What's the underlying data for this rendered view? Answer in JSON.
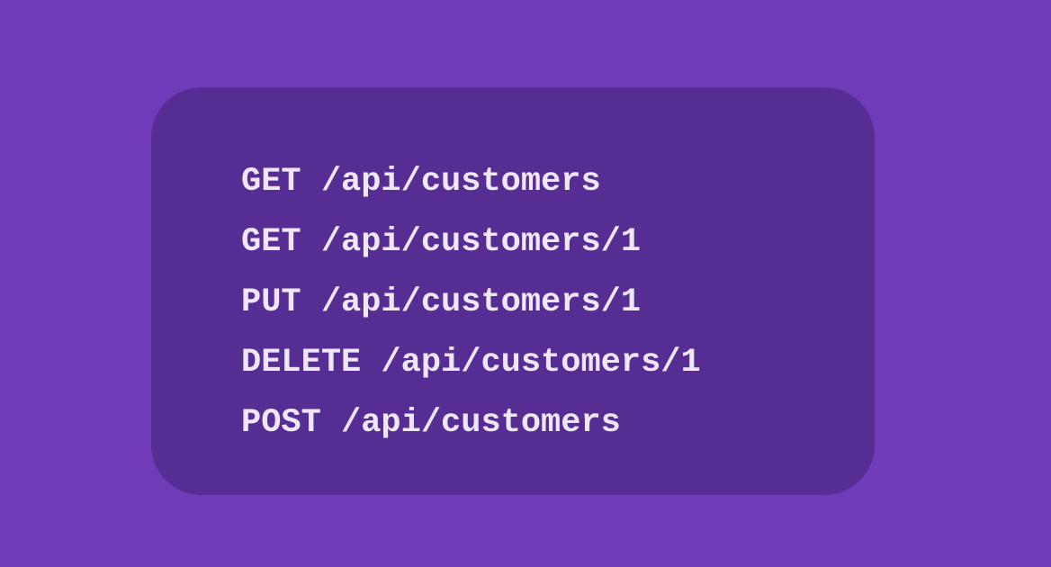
{
  "colors": {
    "background": "#6f3bb9",
    "card": "#552d93",
    "text": "#efe6f8"
  },
  "routes": [
    "GET /api/customers",
    "GET /api/customers/1",
    "PUT /api/customers/1",
    "DELETE /api/customers/1",
    "POST /api/customers"
  ]
}
